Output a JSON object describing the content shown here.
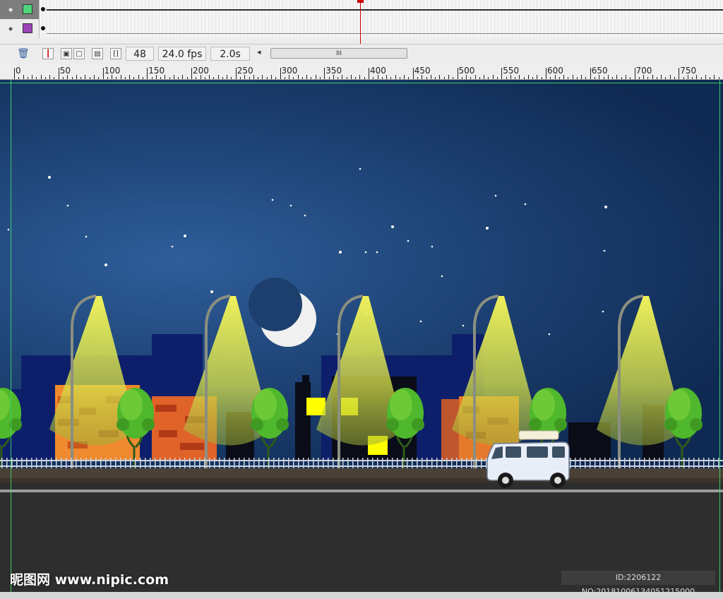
{
  "timeline": {
    "layers": [
      {
        "swatch_color": "#4fd67a",
        "icon": "dot-icon"
      },
      {
        "swatch_color": "#9b45b6",
        "icon": "dot-icon"
      }
    ],
    "current_frame": "48",
    "frame_rate": "24.0 fps",
    "elapsed_time": "2.0s",
    "scroll_label": "III",
    "scroll_arrow": "◂"
  },
  "ruler": {
    "labels": [
      "0",
      "50",
      "100",
      "150",
      "200",
      "250",
      "300",
      "350",
      "400",
      "450",
      "500",
      "550",
      "600",
      "650",
      "700",
      "750"
    ]
  },
  "stage": {
    "sky_color": "#15355f",
    "road_color": "#2e2e2e",
    "lamp_light_color": "#f1f35a",
    "tree_color": "#4fb82c",
    "window_color": "#ffff00"
  },
  "watermark": {
    "site": "昵图网 www.nipic.com",
    "id_text": "ID:2206122 NO:20181006134051215000"
  }
}
